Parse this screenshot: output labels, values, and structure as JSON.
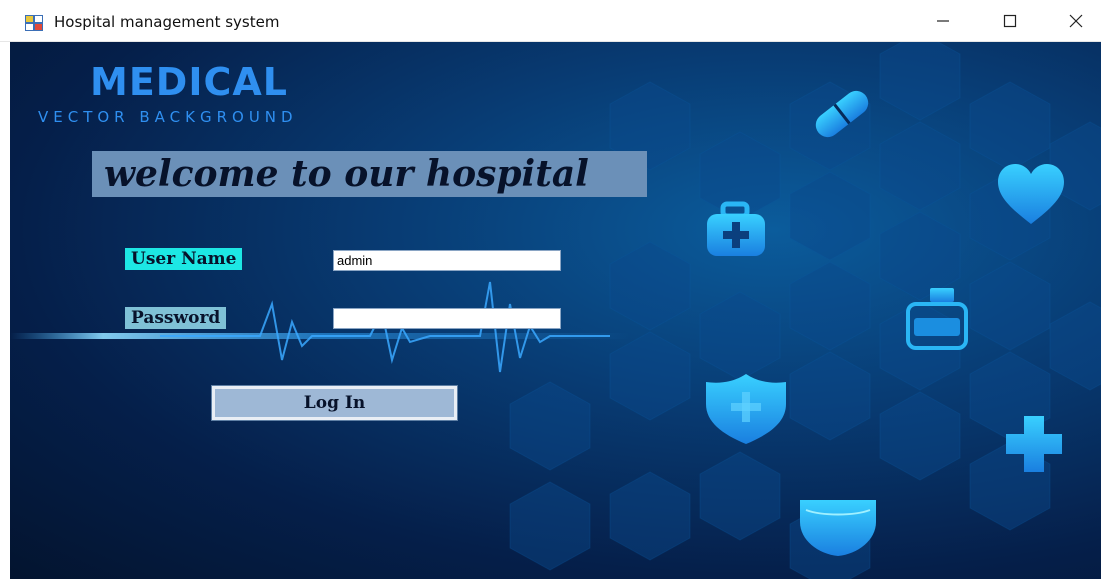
{
  "window": {
    "title": "Hospital management system",
    "controls": {
      "minimize_icon": "minimize-icon",
      "maximize_icon": "maximize-icon",
      "close_icon": "close-icon"
    }
  },
  "brand": {
    "title": "MEDICAL",
    "subtitle": "VECTOR BACKGROUND"
  },
  "welcome_text": "welcome to our hospital",
  "form": {
    "username_label": "User Name",
    "username_value": "admin",
    "password_label": "Password",
    "password_value": "",
    "login_label": "Log In"
  },
  "colors": {
    "background_dark": "#051f4a",
    "accent_blue": "#2f8ff0",
    "icon_cyan": "#1fb7f0",
    "username_label_bg": "#1de7e4",
    "password_label_bg": "#7fc1d6",
    "welcome_banner_bg": "#6b90b8"
  }
}
